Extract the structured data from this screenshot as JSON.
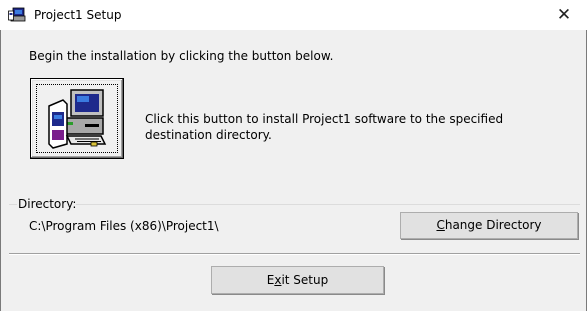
{
  "window": {
    "title": "Project1 Setup",
    "close_glyph": "✕",
    "icon": "setup-computer-icon"
  },
  "intro_text": "Begin the installation by clicking the button below.",
  "install": {
    "icon": "computer-install-icon",
    "description": "Click this button to install Project1 software to the specified destination directory."
  },
  "directory": {
    "legend": "Directory:",
    "path": "C:\\Program Files (x86)\\Project1\\",
    "change_button": {
      "mnemonic": "C",
      "rest": "hange Directory"
    }
  },
  "exit_button": {
    "before": "E",
    "mnemonic": "x",
    "after": "it Setup"
  }
}
